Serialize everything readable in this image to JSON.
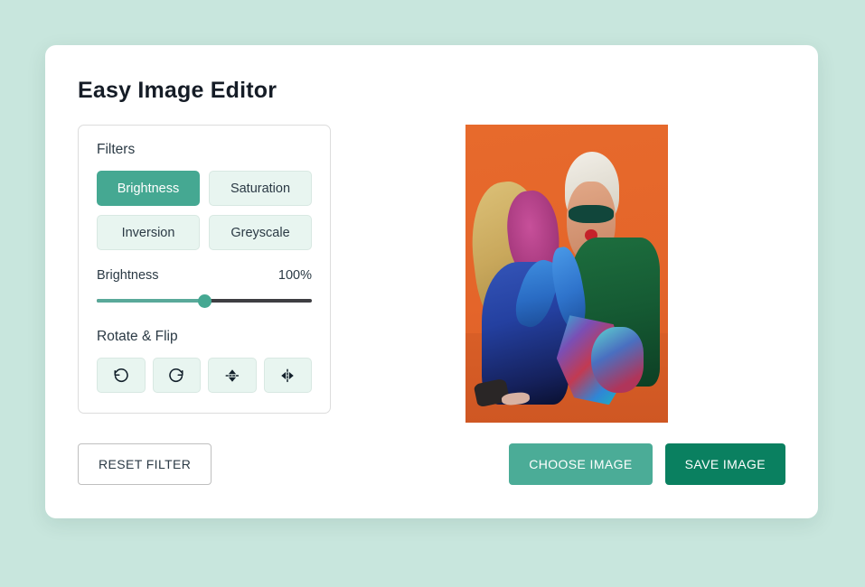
{
  "app": {
    "title": "Easy Image Editor",
    "background_color": "#c8e6dd",
    "card_color": "#ffffff"
  },
  "filters_panel": {
    "heading": "Filters",
    "buttons": [
      {
        "label": "Brightness",
        "active": true
      },
      {
        "label": "Saturation",
        "active": false
      },
      {
        "label": "Inversion",
        "active": false
      },
      {
        "label": "Greyscale",
        "active": false
      }
    ],
    "active_color": "#45a892",
    "inactive_color": "#e8f5f0"
  },
  "slider": {
    "label": "Brightness",
    "value_text": "100%",
    "value": 100,
    "min": 0,
    "max": 200,
    "percent_position": 50,
    "fill_color": "#5aa99a",
    "track_color": "#3e3e42",
    "thumb_color": "#45a892"
  },
  "rotate_flip": {
    "heading": "Rotate & Flip",
    "buttons": [
      {
        "icon": "rotate-left-icon",
        "name": "rotate-left-button"
      },
      {
        "icon": "rotate-right-icon",
        "name": "rotate-right-button"
      },
      {
        "icon": "flip-vertical-icon",
        "name": "flip-vertical-button"
      },
      {
        "icon": "flip-horizontal-icon",
        "name": "flip-horizontal-button"
      }
    ]
  },
  "actions": {
    "reset_label": "RESET FILTER",
    "choose_label": "CHOOSE IMAGE",
    "save_label": "SAVE IMAGE",
    "choose_color": "#4bac97",
    "save_color": "#0a8060"
  },
  "preview": {
    "alt": "two models posing against an orange studio backdrop",
    "background_color": "#e2632a"
  }
}
